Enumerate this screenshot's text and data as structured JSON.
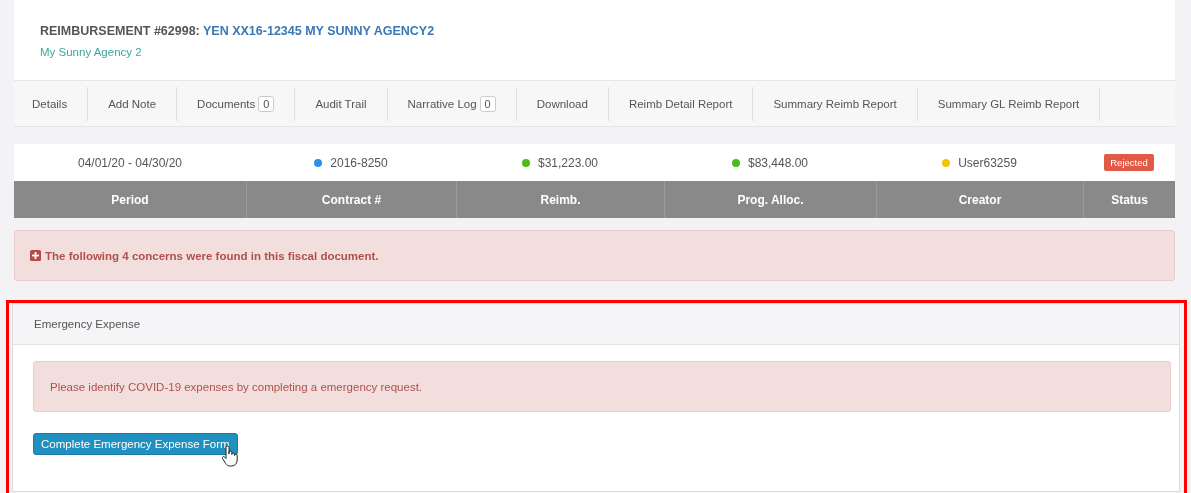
{
  "header": {
    "label": "REIMBURSEMENT #62998:",
    "title": "YEN XX16-12345 MY SUNNY AGENCY2",
    "subtitle": "My Sunny Agency 2"
  },
  "tabs": [
    {
      "label": "Details"
    },
    {
      "label": "Add Note"
    },
    {
      "label": "Documents",
      "count": "0"
    },
    {
      "label": "Audit Trail"
    },
    {
      "label": "Narrative Log",
      "count": "0"
    },
    {
      "label": "Download"
    },
    {
      "label": "Reimb Detail Report"
    },
    {
      "label": "Summary Reimb Report"
    },
    {
      "label": "Summary GL Reimb Report"
    }
  ],
  "summary": {
    "cells": [
      {
        "kind": "text",
        "text": "04/01/20 - 04/30/20"
      },
      {
        "kind": "dot",
        "text": "2016-8250",
        "color": "#2e8fe6"
      },
      {
        "kind": "dot",
        "text": "$31,223.00",
        "color": "#4cbb17"
      },
      {
        "kind": "dot",
        "text": "$83,448.00",
        "color": "#4cbb17"
      },
      {
        "kind": "dot",
        "text": "User63259",
        "color": "#f5c400"
      },
      {
        "kind": "badge",
        "text": "Rejected",
        "color": "#e05a47"
      }
    ],
    "columns": [
      "Period",
      "Contract #",
      "Reimb.",
      "Prog. Alloc.",
      "Creator",
      "Status"
    ]
  },
  "concerns_alert": {
    "text": "The following 4 concerns were found in this fiscal document.",
    "expanded": false
  },
  "emergency_panel": {
    "highlighted": true,
    "title": "Emergency Expense",
    "message": "Please identify COVID-19 expenses by completing a emergency request.",
    "button": "Complete Emergency Expense Form"
  }
}
